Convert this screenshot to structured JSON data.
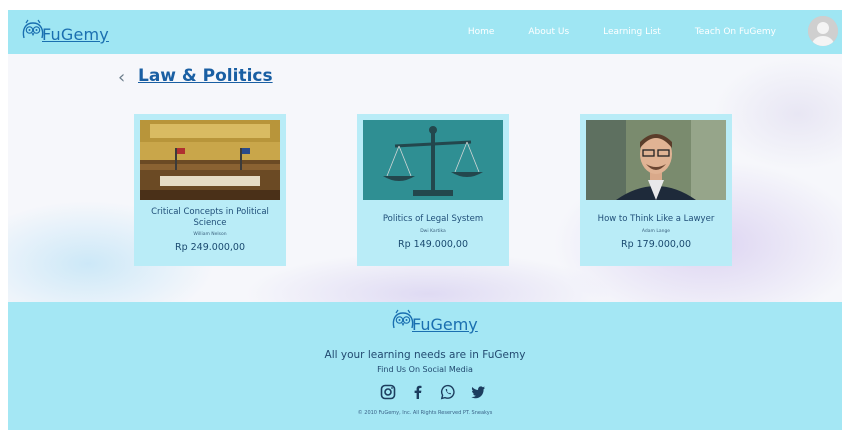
{
  "header": {
    "logo_text": "FuGemy",
    "nav": [
      {
        "label": "Home"
      },
      {
        "label": "About Us"
      },
      {
        "label": "Learning List"
      },
      {
        "label": "Teach On FuGemy"
      }
    ]
  },
  "page": {
    "back_icon": "chevron-left-icon",
    "title": "Law & Politics"
  },
  "courses": [
    {
      "title": "Critical Concepts in Political Science",
      "author": "William Nelson",
      "price": "Rp 249.000,00"
    },
    {
      "title": "Politics of Legal System",
      "author": "Dwi Kartika",
      "price": "Rp 149.000,00"
    },
    {
      "title": "How to Think Like a Lawyer",
      "author": "Adam Lange",
      "price": "Rp 179.000,00"
    }
  ],
  "footer": {
    "logo_text": "FuGemy",
    "tagline": "All your learning needs are in FuGemy",
    "find_us": "Find Us On Social Media",
    "socials": [
      "instagram-icon",
      "facebook-icon",
      "whatsapp-icon",
      "twitter-icon"
    ],
    "copyright": "© 2010 FuGemy, Inc. All Rights Reserved PT. Sneakys"
  },
  "colors": {
    "header_bg": "#9fe6f3",
    "card_bg": "#b9ecf7",
    "footer_bg": "#a4e7f4",
    "brand_blue": "#1a6fb0"
  }
}
